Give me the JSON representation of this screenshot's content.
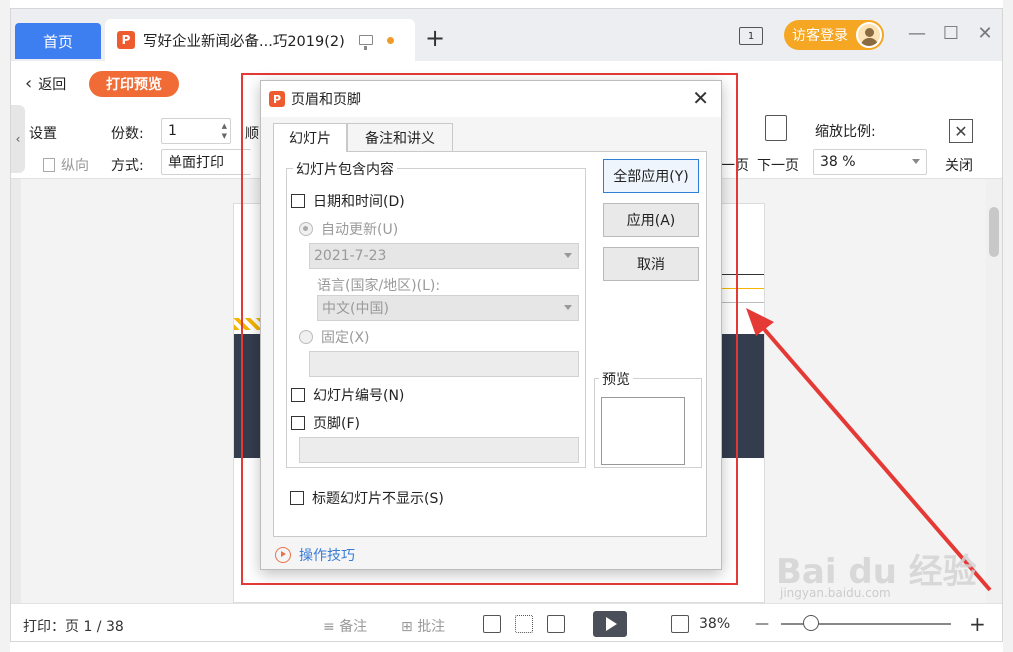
{
  "titlebar": {
    "home_tab": "首页",
    "doc_tab_title": "写好企业新闻必备...巧2019(2)",
    "new_tab": "+",
    "screen_icon_label": "1",
    "login_label": "访客登录",
    "minimize": "—",
    "maximize": "☐",
    "close": "✕"
  },
  "toolbar": {
    "back_label": "返回",
    "print_preview_label": "打印预览",
    "settings_label": "设置",
    "portrait_label": "纵向",
    "copies_label": "份数:",
    "copies_value": "1",
    "order_label": "顺",
    "method_label": "方式:",
    "method_value": "单面打印",
    "prev_page_label": "一页",
    "next_page_label": "下一页",
    "zoom_ratio_label": "缩放比例:",
    "zoom_ratio_value": "38 %",
    "close_label": "关闭"
  },
  "statusbar": {
    "print_page": "打印：页 1 / 38",
    "notes_label": "备注",
    "annotate_label": "批注",
    "zoom_value": "38%",
    "zoom_minus": "—",
    "zoom_plus": "+"
  },
  "dialog": {
    "title": "页眉和页脚",
    "close": "✕",
    "tabs": [
      {
        "label": "幻灯片",
        "active": true
      },
      {
        "label": "备注和讲义",
        "active": false
      }
    ],
    "group_title": "幻灯片包含内容",
    "date_time": "日期和时间(D)",
    "auto_update": "自动更新(U)",
    "date_value": "2021-7-23",
    "language_label": "语言(国家/地区)(L):",
    "language_value": "中文(中国)",
    "fixed": "固定(X)",
    "slide_number": "幻灯片编号(N)",
    "footer": "页脚(F)",
    "hide_on_title": "标题幻灯片不显示(S)",
    "apply_all": "全部应用(Y)",
    "apply": "应用(A)",
    "cancel": "取消",
    "preview_label": "预览",
    "tips": "操作技巧"
  },
  "watermark": {
    "main": "Bai du 经验",
    "sub": "jingyan.baidu.com"
  },
  "colors": {
    "accent_blue": "#3d7ef0",
    "accent_orange": "#f06b35",
    "login_orange": "#f5a623",
    "annotation_red": "#e53935"
  }
}
